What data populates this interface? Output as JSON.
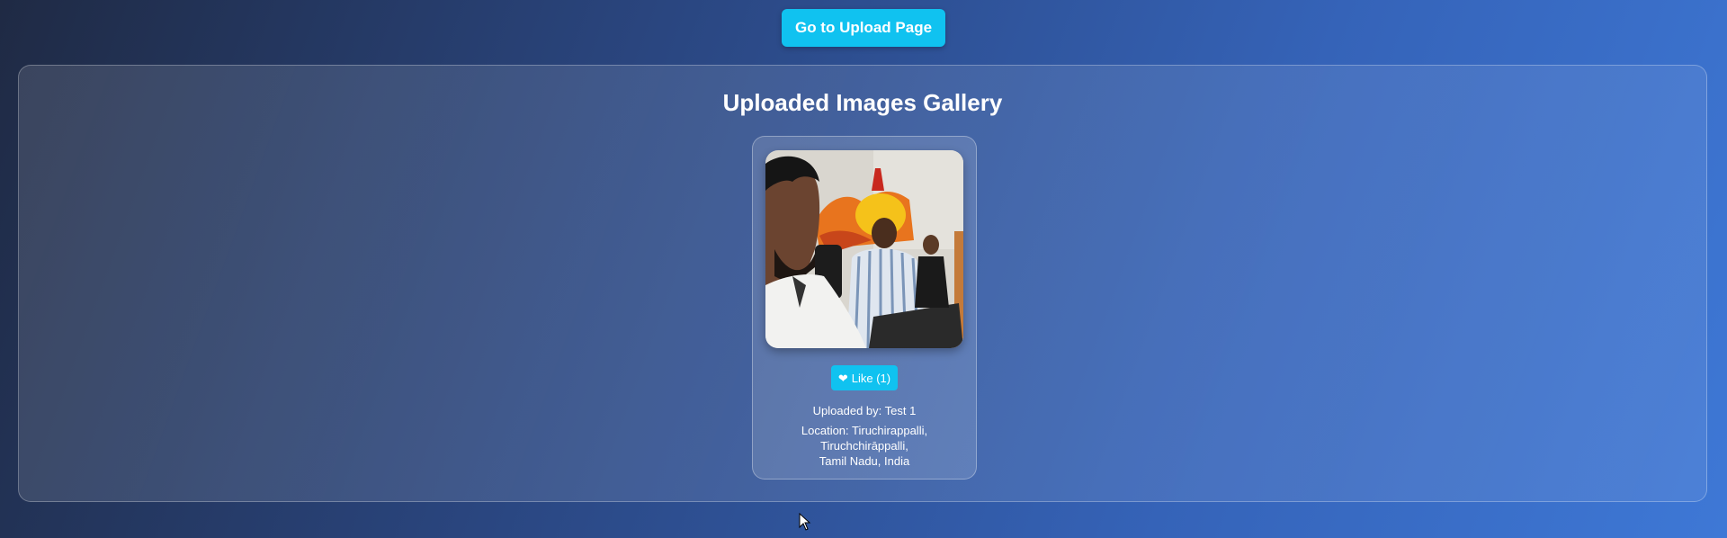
{
  "header": {
    "upload_button_label": "Go to Upload Page"
  },
  "gallery": {
    "title": "Uploaded Images Gallery",
    "items": [
      {
        "image_alt": "group photo in office",
        "like_label": "Like (1)",
        "uploaded_by": "Uploaded by: Test 1",
        "location_line1": "Location: Tiruchirappalli,",
        "location_line2": "Tiruchchirāppalli,",
        "location_line3": "Tamil Nadu, India"
      }
    ]
  },
  "colors": {
    "accent": "#10c2f0",
    "background_start": "#1f2a44",
    "background_end": "#3e78d6"
  },
  "icons": {
    "like": "heart-icon",
    "pointer": "cursor-icon"
  }
}
